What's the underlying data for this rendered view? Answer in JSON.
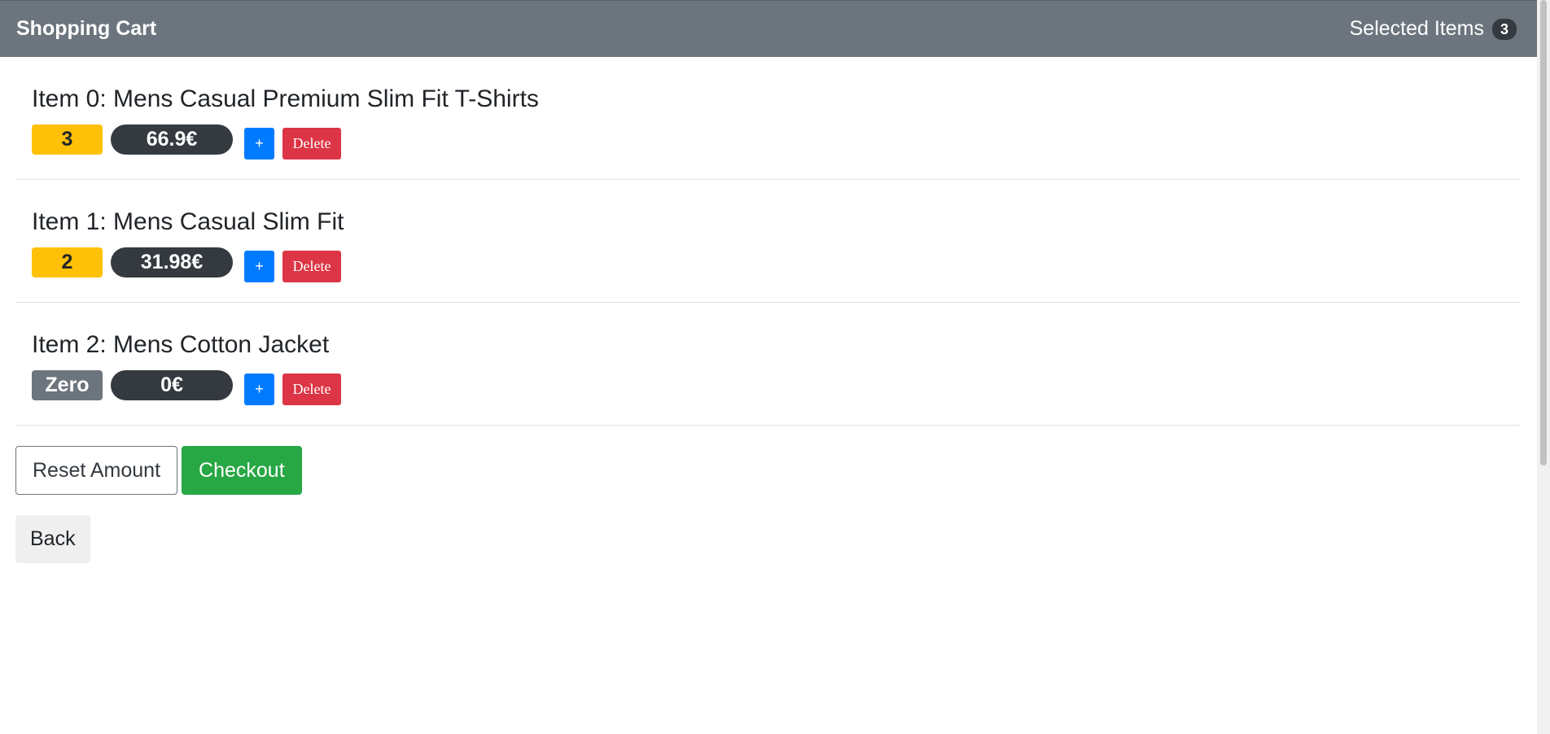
{
  "navbar": {
    "brand": "Shopping Cart",
    "selected_label": "Selected Items",
    "selected_count": "3"
  },
  "items": [
    {
      "title": "Item 0: Mens Casual Premium Slim Fit T-Shirts",
      "quantity": "3",
      "price": "66.9€",
      "plus_label": "+",
      "delete_label": "Delete"
    },
    {
      "title": "Item 1: Mens Casual Slim Fit",
      "quantity": "2",
      "price": "31.98€",
      "plus_label": "+",
      "delete_label": "Delete"
    },
    {
      "title": "Item 2: Mens Cotton Jacket",
      "quantity": "Zero",
      "price": "0€",
      "plus_label": "+",
      "delete_label": "Delete"
    }
  ],
  "actions": {
    "reset_label": "Reset Amount",
    "checkout_label": "Checkout",
    "back_label": "Back"
  },
  "colors": {
    "navbar": "#6c757d",
    "qty_warning": "#ffc107",
    "qty_zero": "#6c757d",
    "price": "#343a40",
    "plus": "#007bff",
    "delete": "#dc3545",
    "checkout": "#28a745"
  }
}
